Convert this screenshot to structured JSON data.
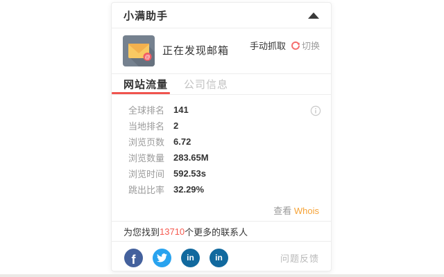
{
  "panel": {
    "title": "小满助手",
    "discover": {
      "status_text": "正在发现邮箱",
      "manual_grab_label": "手动抓取",
      "switch_label": "切换",
      "mail_icon": "envelope-with-at-badge"
    },
    "tabs": [
      {
        "label": "网站流量",
        "active": true
      },
      {
        "label": "公司信息",
        "active": false
      }
    ],
    "stats": {
      "rows": [
        {
          "label": "全球排名",
          "value": "141"
        },
        {
          "label": "当地排名",
          "value": "2"
        },
        {
          "label": "浏览页数",
          "value": "6.72"
        },
        {
          "label": "浏览数量",
          "value": "283.65M"
        },
        {
          "label": "浏览时间",
          "value": "592.53s"
        },
        {
          "label": "跳出比率",
          "value": "32.29%"
        }
      ],
      "info_icon": "info-circle",
      "whois_prefix": "查看",
      "whois_link": "Whois"
    },
    "contacts": {
      "prefix": "为您找到",
      "count": "13710",
      "suffix": "个更多的联系人"
    },
    "footer": {
      "social_icons": [
        "facebook",
        "twitter",
        "linkedin",
        "linkedin"
      ],
      "feedback_label": "问题反馈"
    },
    "colors": {
      "accent_red": "#F0544E",
      "link_orange": "#F6A337",
      "count_red": "#F55A50",
      "switch_red": "#F56C6C",
      "facebook_blue": "#44619D",
      "twitter_blue": "#29A3EF",
      "linkedin_blue": "#11699E",
      "icon_slate": "#75818F",
      "envelope_orange": "#F9C963"
    }
  }
}
